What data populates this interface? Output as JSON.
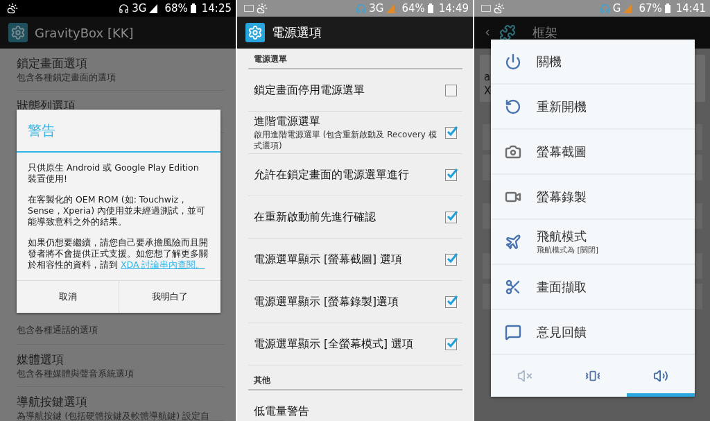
{
  "left_screen": {
    "status_bar": {
      "network": "3G",
      "battery": "68%",
      "time": "14:25"
    },
    "action_bar": {
      "title": "GravityBox [KK]"
    },
    "list": [
      {
        "title": "鎖定畫面選項",
        "subtitle": "包含各種鎖定畫面的選項"
      },
      {
        "title": "狀態列選項"
      },
      {
        "subtitle": "包含各種通話的選項"
      },
      {
        "title": "媒體選項",
        "subtitle": "包含各種媒體與聲音系統選項"
      },
      {
        "title": "導航按鍵選項",
        "subtitle": "為導航按鍵 (包括硬體按鍵及軟體導航鍵) 設定自"
      }
    ],
    "dialog": {
      "title": "警告",
      "paragraphs": [
        {
          "text": "只供原生 Android 或 Google Play Edition 裝置使用!"
        },
        {
          "text": "在客製化的 OEM ROM (如: Touchwiz，Sense，Xperia) 內使用並未經過測試，並可能導致意料之外的結果。"
        },
        {
          "text": "如果仍想要繼續，請您自己要承擔風險而且開發者將不會提供正式支援。如您想了解更多關於相容性的資料，請到",
          "link": "XDA 討論串內查閱。"
        }
      ],
      "buttons": [
        "取消",
        "我明白了"
      ]
    }
  },
  "middle_screen": {
    "status_bar": {
      "network": "3G",
      "battery": "64%",
      "time": "14:49"
    },
    "action_bar": {
      "title": "電源選項"
    },
    "sections": [
      {
        "header": "電源選單",
        "rows": [
          {
            "kind": "checkbox",
            "title": "鎖定畫面停用電源選單",
            "checked": false
          },
          {
            "kind": "checkbox",
            "title": "進階電源選單",
            "subtitle": "啟用進階電源選單 (包含重新啟動及 Recovery 模式選項)",
            "checked": true
          },
          {
            "kind": "checkbox",
            "title": "允許在鎖定畫面的電源選單進行",
            "checked": true
          },
          {
            "kind": "checkbox",
            "title": "在重新啟動前先進行確認",
            "checked": true
          },
          {
            "kind": "checkbox",
            "title": "電源選單顯示 [螢幕截圖] 選項",
            "checked": true
          },
          {
            "kind": "checkbox",
            "title": "電源選單顯示 [螢幕錄製]選項",
            "checked": true
          },
          {
            "kind": "checkbox",
            "title": "電源選單顯示 [全螢幕模式] 選項",
            "checked": true
          }
        ]
      },
      {
        "header": "其他",
        "rows": [
          {
            "kind": "plain",
            "title": "低電量警告"
          }
        ]
      }
    ]
  },
  "right_screen": {
    "status_bar": {
      "network": "G",
      "battery": "67%",
      "time": "14:41"
    },
    "action_bar": {
      "title": "框架"
    },
    "background_card": {
      "lines": [
        "a",
        "X"
      ]
    },
    "power_menu": {
      "items": [
        {
          "kind": "power",
          "title": "關機"
        },
        {
          "kind": "restart",
          "title": "重新開機"
        },
        {
          "kind": "screenshot",
          "title": "螢幕截圖"
        },
        {
          "kind": "record",
          "title": "螢幕錄製"
        },
        {
          "kind": "airplane",
          "title": "飛航模式",
          "subtitle": "飛航模式為 [關閉]"
        },
        {
          "kind": "capture",
          "title": "畫面擷取"
        },
        {
          "kind": "feedback",
          "title": "意見回饋"
        }
      ],
      "sound_modes": [
        {
          "kind": "silent",
          "selected": false
        },
        {
          "kind": "vibrate",
          "selected": false
        },
        {
          "kind": "sound",
          "selected": true
        }
      ]
    }
  }
}
